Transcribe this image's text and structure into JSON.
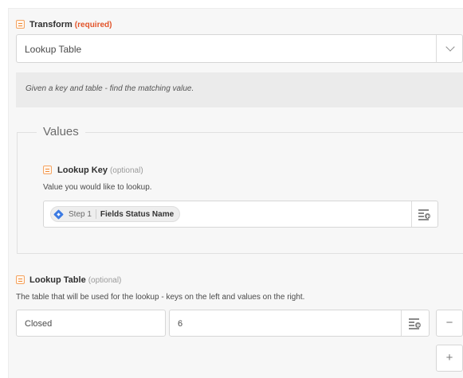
{
  "transform": {
    "label": "Transform",
    "required_text": "(required)",
    "selected_value": "Lookup Table",
    "help_text": "Given a key and table - find the matching value."
  },
  "values_section": {
    "legend": "Values",
    "lookup_key": {
      "label": "Lookup Key",
      "optional_text": "(optional)",
      "description": "Value you would like to lookup.",
      "pill": {
        "step": "Step 1",
        "field": "Fields Status Name"
      }
    }
  },
  "lookup_table": {
    "label": "Lookup Table",
    "optional_text": "(optional)",
    "description": "The table that will be used for the lookup - keys on the left and values on the right.",
    "rows": [
      {
        "key": "Closed",
        "value": "6"
      }
    ],
    "remove_glyph": "−",
    "add_glyph": "+"
  },
  "colors": {
    "required": "#e2542a",
    "field_icon": "#f08a34",
    "step_icon": "#3d7be3"
  },
  "icons": {
    "field_type": "text-field-icon",
    "step": "step-diamond-icon",
    "insert": "insert-data-icon",
    "dropdown": "chevron-down-icon"
  }
}
